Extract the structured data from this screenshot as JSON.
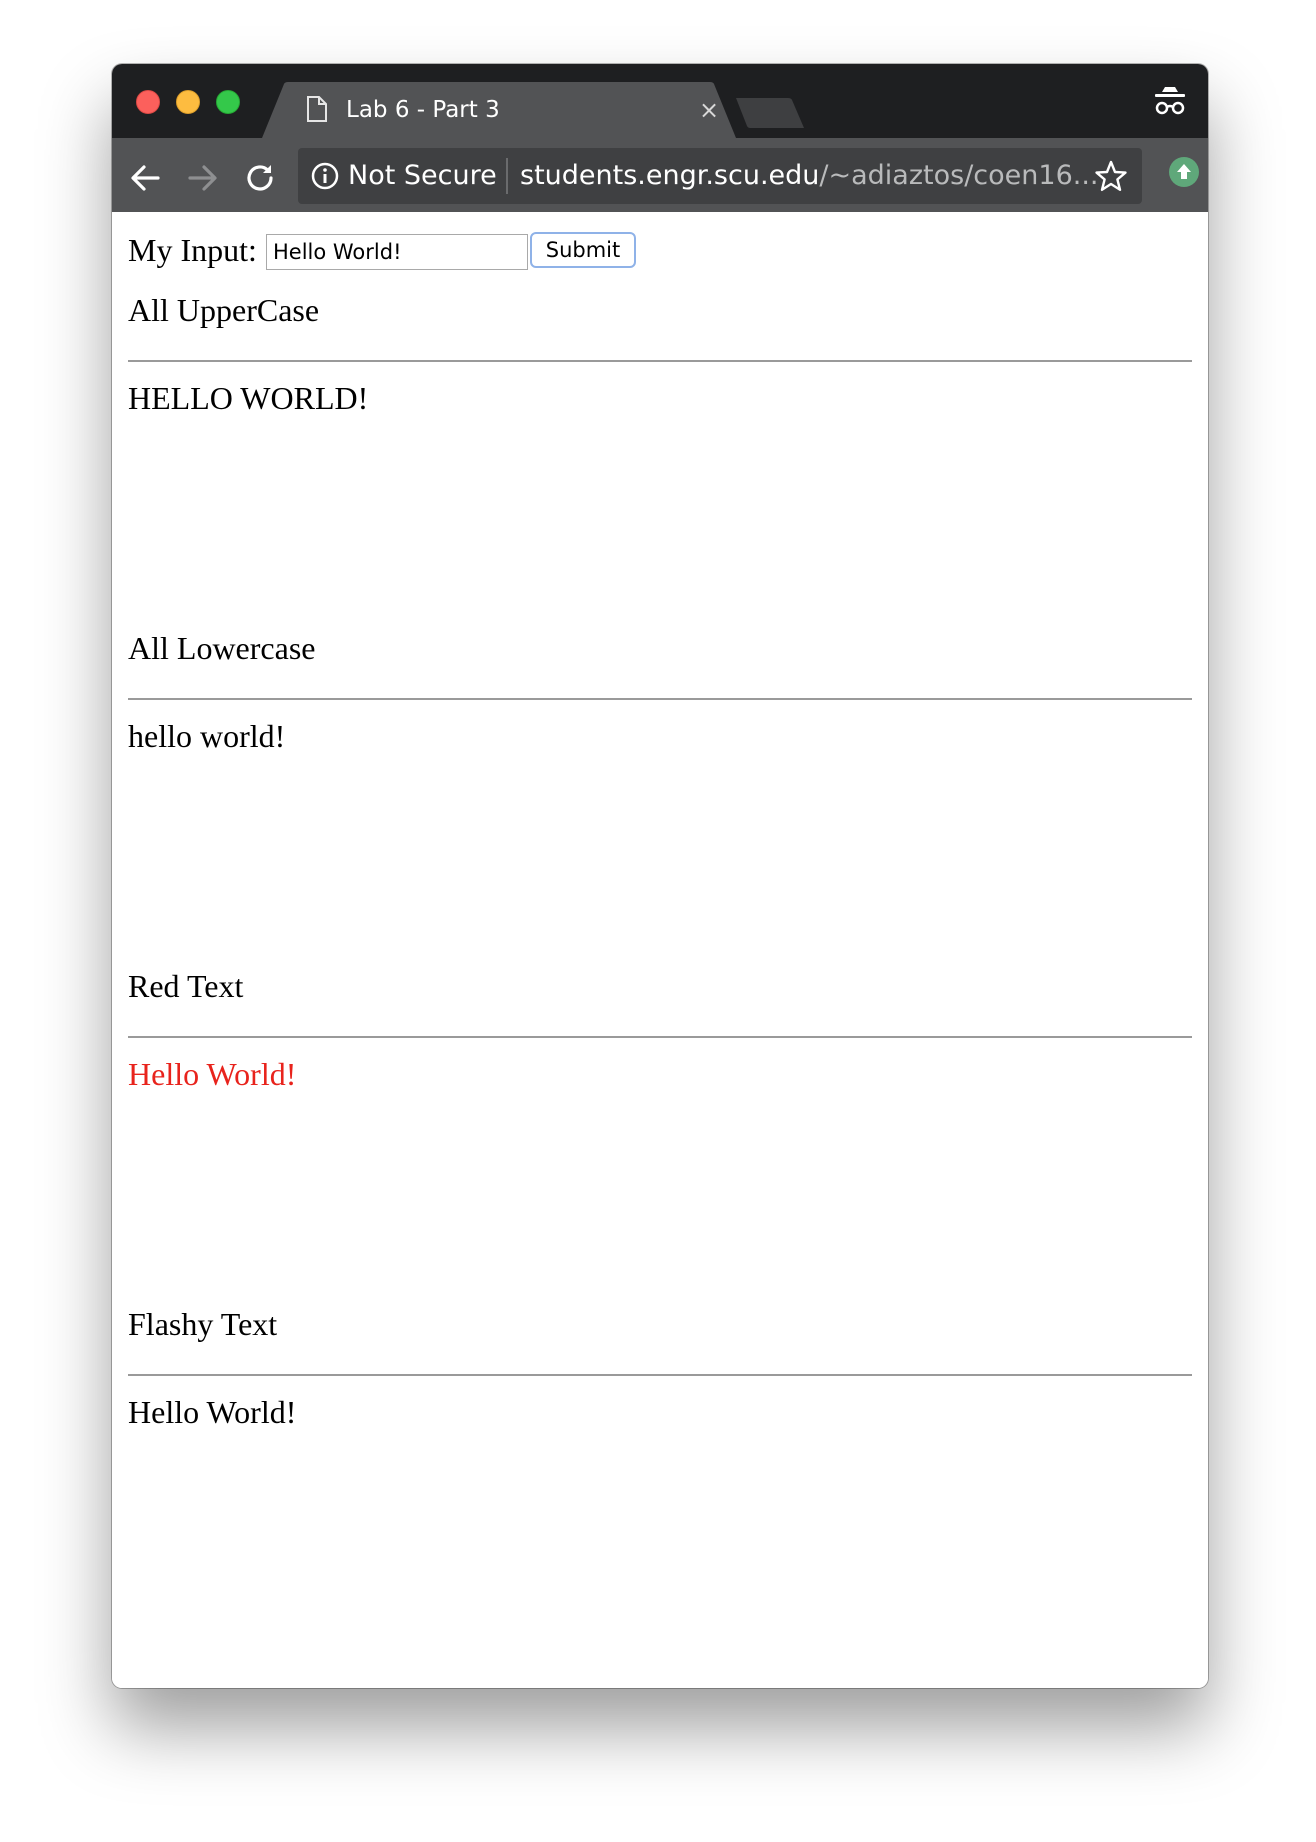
{
  "browser": {
    "tab": {
      "title": "Lab 6 - Part 3",
      "close_glyph": "×",
      "icon": "page-icon"
    },
    "toolbar": {
      "security_label": "Not Secure",
      "url_host": "students.engr.scu.edu",
      "url_path": "/~adiaztos/coen16...",
      "icons": [
        "back-arrow-icon",
        "forward-arrow-icon",
        "reload-icon",
        "info-icon",
        "star-icon",
        "update-extension-icon"
      ]
    },
    "traffic_lights": {
      "close": "#fc605c",
      "minimize": "#fdbc40",
      "maximize": "#34c84a"
    },
    "incognito_icon": "incognito-icon"
  },
  "form": {
    "label": "My Input:",
    "input_value": "Hello World!",
    "submit_label": "Submit"
  },
  "sections": [
    {
      "heading": "All UpperCase",
      "output": "HELLO WORLD!",
      "output_color": "#000000"
    },
    {
      "heading": "All Lowercase",
      "output": "hello world!",
      "output_color": "#000000"
    },
    {
      "heading": "Red Text",
      "output": "Hello World!",
      "output_color": "#e8231c"
    },
    {
      "heading": "Flashy Text",
      "output": "Hello World!",
      "output_color": "#000000"
    }
  ],
  "colors": {
    "tabstrip": "#1e1f21",
    "toolbar": "#525355",
    "omnibox": "#3f4042",
    "extension_badge": "#5fa87a"
  }
}
